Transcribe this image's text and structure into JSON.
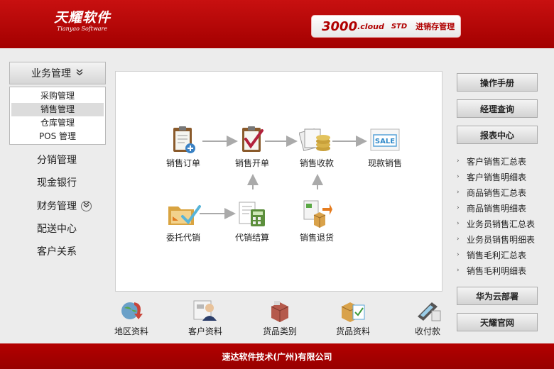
{
  "header": {
    "logo_cn": "天耀软件",
    "logo_en": "Tianyao Software",
    "product_number": "3000",
    "product_cloud": ".cloud",
    "product_edition": "STD",
    "product_name": "进销存管理"
  },
  "left_menu": {
    "active_group": "业务管理",
    "submenu": [
      {
        "label": "采购管理",
        "active": false
      },
      {
        "label": "销售管理",
        "active": true
      },
      {
        "label": "仓库管理",
        "active": false
      },
      {
        "label": "POS 管理",
        "active": false
      }
    ],
    "groups": [
      "分销管理",
      "现金银行",
      "财务管理",
      "配送中心",
      "客户关系"
    ]
  },
  "flow": {
    "sales_order": "销售订单",
    "sales_invoice": "销售开单",
    "sales_receipt": "销售收款",
    "cash_sale": "现款销售",
    "consignment": "委托代销",
    "consignment_settle": "代销结算",
    "sales_return": "销售退货"
  },
  "bottom_bar": [
    "地区资料",
    "客户资料",
    "货品类别",
    "货品资料",
    "收付款"
  ],
  "right_panel": {
    "manual": "操作手册",
    "manager_query": "经理查询",
    "report_center": "报表中心",
    "reports": [
      "客户销售汇总表",
      "客户销售明细表",
      "商品销售汇总表",
      "商品销售明细表",
      "业务员销售汇总表",
      "业务员销售明细表",
      "销售毛利汇总表",
      "销售毛利明细表"
    ],
    "huawei_cloud": "华为云部署",
    "official_site": "天耀官网"
  },
  "footer": {
    "company": "速达软件技术(广州)有限公司"
  },
  "colors": {
    "brand_red": "#b30000",
    "panel_bg": "#ffffff",
    "page_bg": "#ececec"
  }
}
